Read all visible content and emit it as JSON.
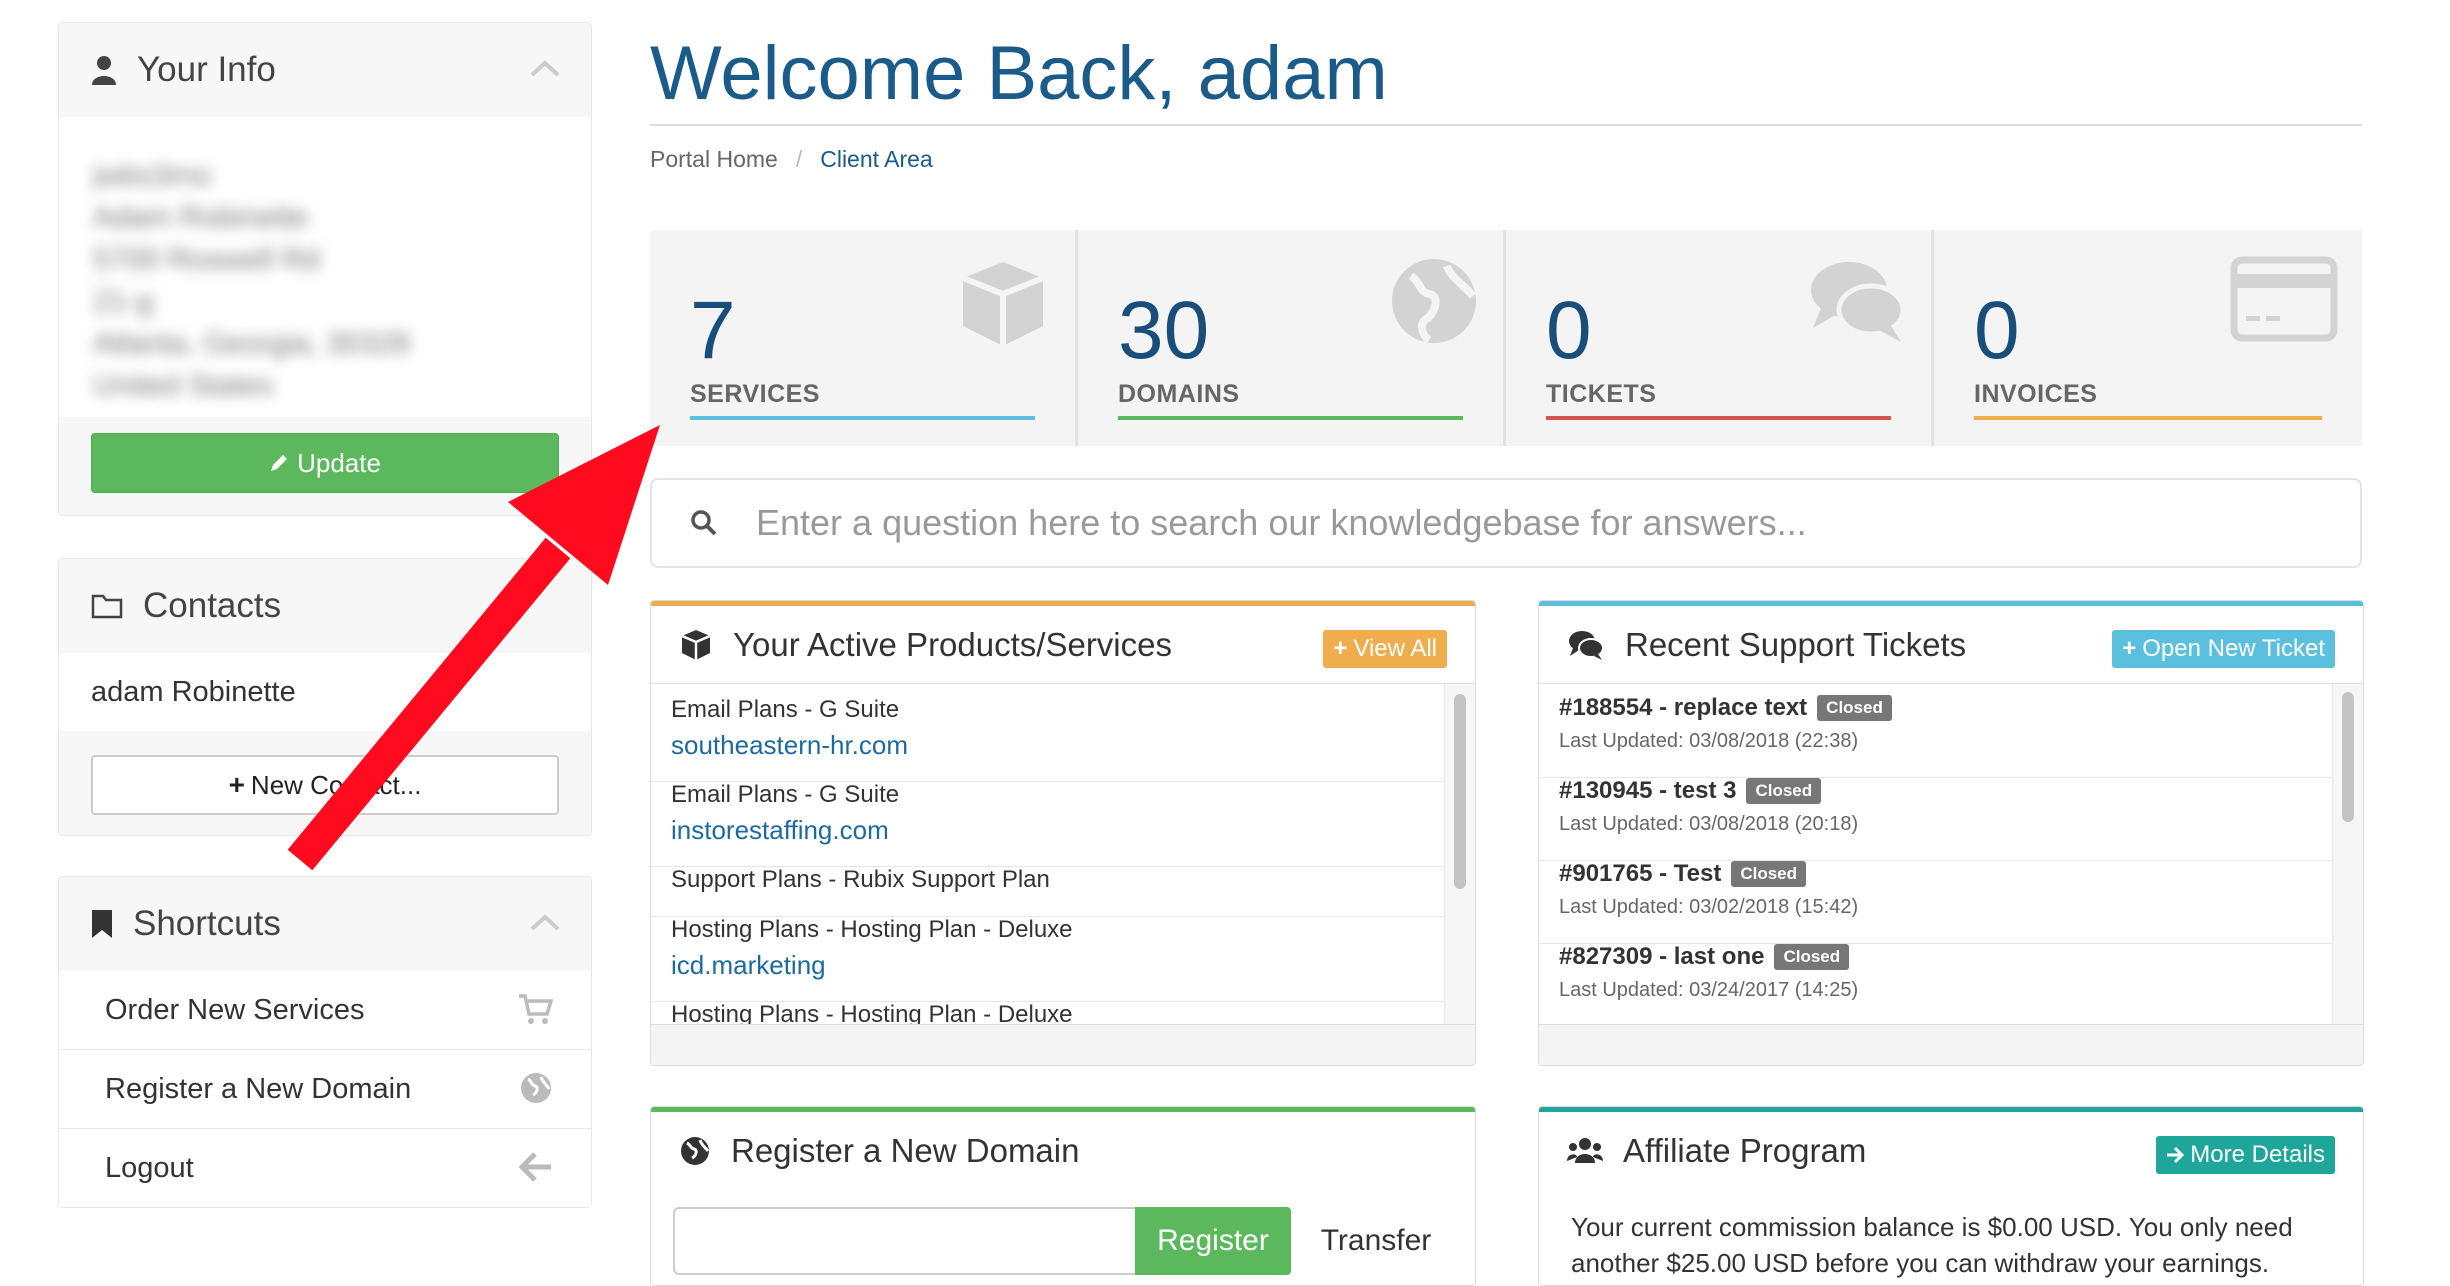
{
  "sidebar": {
    "your_info": {
      "title": "Your Info",
      "blurred_lines": [
        "jwbs3mo",
        "Adam Robinette",
        "5700 Roswell Rd",
        "21-g",
        "Atlanta, Georgia, 30328",
        "United States"
      ],
      "update_label": "Update"
    },
    "contacts": {
      "title": "Contacts",
      "contact_name": "adam Robinette",
      "new_contact_label": "New Contact..."
    },
    "shortcuts": {
      "title": "Shortcuts",
      "items": [
        {
          "label": "Order New Services",
          "icon": "cart-icon"
        },
        {
          "label": "Register a New Domain",
          "icon": "globe-icon"
        },
        {
          "label": "Logout",
          "icon": "arrow-left-icon"
        }
      ]
    }
  },
  "header": {
    "title": "Welcome Back, adam",
    "breadcrumb": {
      "home": "Portal Home",
      "separator": "/",
      "current": "Client Area"
    }
  },
  "stats": [
    {
      "value": "7",
      "label": "SERVICES",
      "color": "#5bc0de",
      "icon": "cube-icon"
    },
    {
      "value": "30",
      "label": "DOMAINS",
      "color": "#5cb85c",
      "icon": "globe-icon"
    },
    {
      "value": "0",
      "label": "TICKETS",
      "color": "#d9534f",
      "icon": "comments-icon"
    },
    {
      "value": "0",
      "label": "INVOICES",
      "color": "#f0ad4e",
      "icon": "credit-card-icon"
    }
  ],
  "search": {
    "placeholder": "Enter a question here to search our knowledgebase for answers..."
  },
  "products": {
    "title": "Your Active Products/Services",
    "button": "View All",
    "accent": "#f0ad4e",
    "items": [
      {
        "name": "Email Plans - G Suite",
        "domain": "southeastern-hr.com"
      },
      {
        "name": "Email Plans - G Suite",
        "domain": "instorestaffing.com"
      },
      {
        "name": "Support Plans - Rubix Support Plan",
        "domain": ""
      },
      {
        "name": "Hosting Plans - Hosting Plan - Deluxe",
        "domain": "icd.marketing"
      },
      {
        "name": "Hosting Plans - Hosting Plan - Deluxe",
        "domain": ""
      }
    ]
  },
  "tickets": {
    "title": "Recent Support Tickets",
    "button": "Open New Ticket",
    "accent": "#5bc0de",
    "items": [
      {
        "title": "#188554 - replace text",
        "status": "Closed",
        "updated": "Last Updated: 03/08/2018 (22:38)"
      },
      {
        "title": "#130945 - test 3",
        "status": "Closed",
        "updated": "Last Updated: 03/08/2018 (20:18)"
      },
      {
        "title": "#901765 - Test",
        "status": "Closed",
        "updated": "Last Updated: 03/02/2018 (15:42)"
      },
      {
        "title": "#827309 - last one",
        "status": "Closed",
        "updated": "Last Updated: 03/24/2017 (14:25)"
      }
    ]
  },
  "register_domain": {
    "title": "Register a New Domain",
    "register_label": "Register",
    "transfer_label": "Transfer",
    "accent": "#5cb85c"
  },
  "affiliate": {
    "title": "Affiliate Program",
    "button": "More Details",
    "accent": "#1fa69a",
    "text": "Your current commission balance is $0.00 USD. You only need another $25.00 USD before you can withdraw your earnings."
  },
  "annotation": {
    "color": "#ff0a1e"
  }
}
